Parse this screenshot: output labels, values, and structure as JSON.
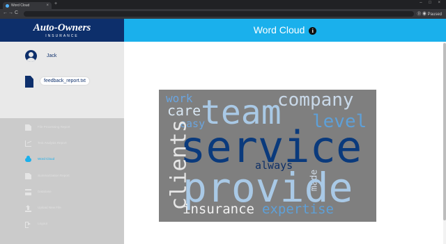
{
  "browser": {
    "tab_title": "Word Cloud",
    "tab_close": "×",
    "new_tab": "+",
    "window_controls": "– □ ×",
    "back": "←",
    "forward": "→",
    "reload": "C",
    "home": "⌂",
    "profile": "Ⓓ ◉ Paused"
  },
  "brand": {
    "name": "Auto-Owners",
    "subtitle": "INSURANCE"
  },
  "header": {
    "title": "Word Cloud",
    "info": "i"
  },
  "user": {
    "name": "Jack"
  },
  "file": {
    "name": "feedback_report.txt"
  },
  "menu": [
    {
      "label": "File Processing Report",
      "icon": "document-icon"
    },
    {
      "label": "Text Analysis Report",
      "icon": "chart-icon"
    },
    {
      "label": "Word Cloud",
      "icon": "cloud-icon",
      "active": true
    },
    {
      "label": "Summarization Report",
      "icon": "document-icon"
    },
    {
      "label": "Database",
      "icon": "list-icon"
    },
    {
      "label": "Upload New File",
      "icon": "upload-icon"
    },
    {
      "label": "Logout",
      "icon": "logout-icon"
    }
  ],
  "word_cloud": {
    "words": [
      {
        "text": "service",
        "color": "#0a3a7c"
      },
      {
        "text": "provide",
        "color": "#a9c9e6"
      },
      {
        "text": "team",
        "color": "#a9c9e6"
      },
      {
        "text": "company",
        "color": "#c9d9e9"
      },
      {
        "text": "clients",
        "color": "#e6e6e6"
      },
      {
        "text": "level",
        "color": "#5ea0d8"
      },
      {
        "text": "care",
        "color": "#d8e6f2"
      },
      {
        "text": "work",
        "color": "#6aa5e0"
      },
      {
        "text": "easy",
        "color": "#6aa5e0"
      },
      {
        "text": "always",
        "color": "#0e2f66"
      },
      {
        "text": "made",
        "color": "#d0dae6"
      },
      {
        "text": "insurance",
        "color": "#f1f1f1"
      },
      {
        "text": "expertise",
        "color": "#5ea0d8"
      }
    ]
  },
  "colors": {
    "navy": "#0d2f6b",
    "accent": "#1ab0ec",
    "cloud_bg": "#7f7f7f"
  }
}
